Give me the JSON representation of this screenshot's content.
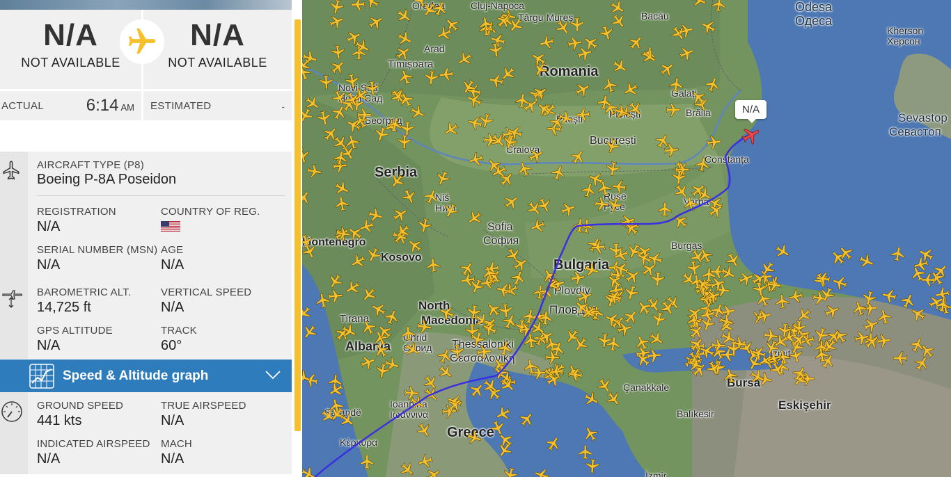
{
  "route": {
    "origin_code": "N/A",
    "origin_name": "NOT AVAILABLE",
    "destination_code": "N/A",
    "destination_name": "NOT AVAILABLE"
  },
  "times": {
    "actual_label": "ACTUAL",
    "actual_time": "6:14",
    "actual_ampm": "AM",
    "estimated_label": "ESTIMATED",
    "estimated_value": "-"
  },
  "aircraft": {
    "type_label": "AIRCRAFT TYPE",
    "type_code": "(P8)",
    "type_value": "Boeing P-8A Poseidon",
    "registration_label": "REGISTRATION",
    "registration_value": "N/A",
    "country_label": "COUNTRY OF REG.",
    "serial_label": "SERIAL NUMBER (MSN)",
    "serial_value": "N/A",
    "age_label": "AGE",
    "age_value": "N/A"
  },
  "altitude": {
    "baro_label": "BAROMETRIC ALT.",
    "baro_value": "14,725 ft",
    "vs_label": "VERTICAL SPEED",
    "vs_value": "N/A",
    "gps_label": "GPS ALTITUDE",
    "gps_value": "N/A",
    "track_label": "TRACK",
    "track_value": "60°"
  },
  "graph": {
    "label": "Speed & Altitude graph"
  },
  "speed": {
    "ground_label": "GROUND SPEED",
    "ground_value": "441 kts",
    "tas_label": "TRUE AIRSPEED",
    "tas_value": "N/A",
    "ias_label": "INDICATED AIRSPEED",
    "ias_value": "N/A",
    "mach_label": "MACH",
    "mach_value": "N/A"
  },
  "map": {
    "callout": "N/A",
    "labels": {
      "romania": "Romania",
      "serbia": "Serbia",
      "bulgaria": "Bulgaria",
      "greece": "Greece",
      "albania": "Albania",
      "kosovo": "Kosovo",
      "north_macedonia_1": "North",
      "north_macedonia_2": "Macedonia",
      "montenegro": "Montenegro",
      "odesa": "Odesa",
      "odesa_cyr": "Одеса",
      "kherson": "Kherson",
      "kherson_cyr": "Херсон",
      "sevastopol": "Sevastop",
      "sevastopol_cyr": "Севастоп",
      "cluj": "Cluj-Napoca",
      "oradea": "Oradea",
      "targu_mures": "Târgu Mureș",
      "bacau": "Bacău",
      "arad": "Arad",
      "timisoara": "Timișoara",
      "novi_sad": "Novi Sad",
      "novi_sad_cyr": "Нови Сад",
      "belgrade_cyr": "Београд",
      "galati": "Galați",
      "braila": "Brăila",
      "pitesti": "Pitești",
      "ploiesti": "Ploiești",
      "bucharest": "București",
      "craiova": "Craiova",
      "constanta": "Constanța",
      "nis": "Niš",
      "nis_cyr": "Ниш",
      "ruse": "Ruse",
      "ruse_cyr": "Русе",
      "sofia": "Sofia",
      "sofia_cyr": "София",
      "varna": "Varna",
      "burgas": "Burgas",
      "plovdiv": "Plovdiv",
      "plovdiv_cyr": "Пловдив",
      "tirana": "Tirana",
      "ohrid": "Ohrid",
      "ohrid_cyr": "Охрид",
      "thessaloniki": "Thessaloniki",
      "thessaloniki_cyr": "Θεσσαλονίκη",
      "canakkale": "Çanakkale",
      "bursa": "Bursa",
      "eskisehir": "Eskişehir",
      "balikesir": "Balıkesir",
      "izmit": "İzmit",
      "ioannina": "Ioannina",
      "ioannina_cyr": "Ιωάννινα",
      "saranda": "Sarandë",
      "kerkyra": "Κέρκυρα",
      "izmir": "İzmir"
    }
  },
  "colors": {
    "accent_yellow": "#f5c02c",
    "bar_blue": "#2f7cbd",
    "track_blue": "#3b2fe0",
    "selected_plane": "#e8474b",
    "sea": "#4d78b3"
  }
}
